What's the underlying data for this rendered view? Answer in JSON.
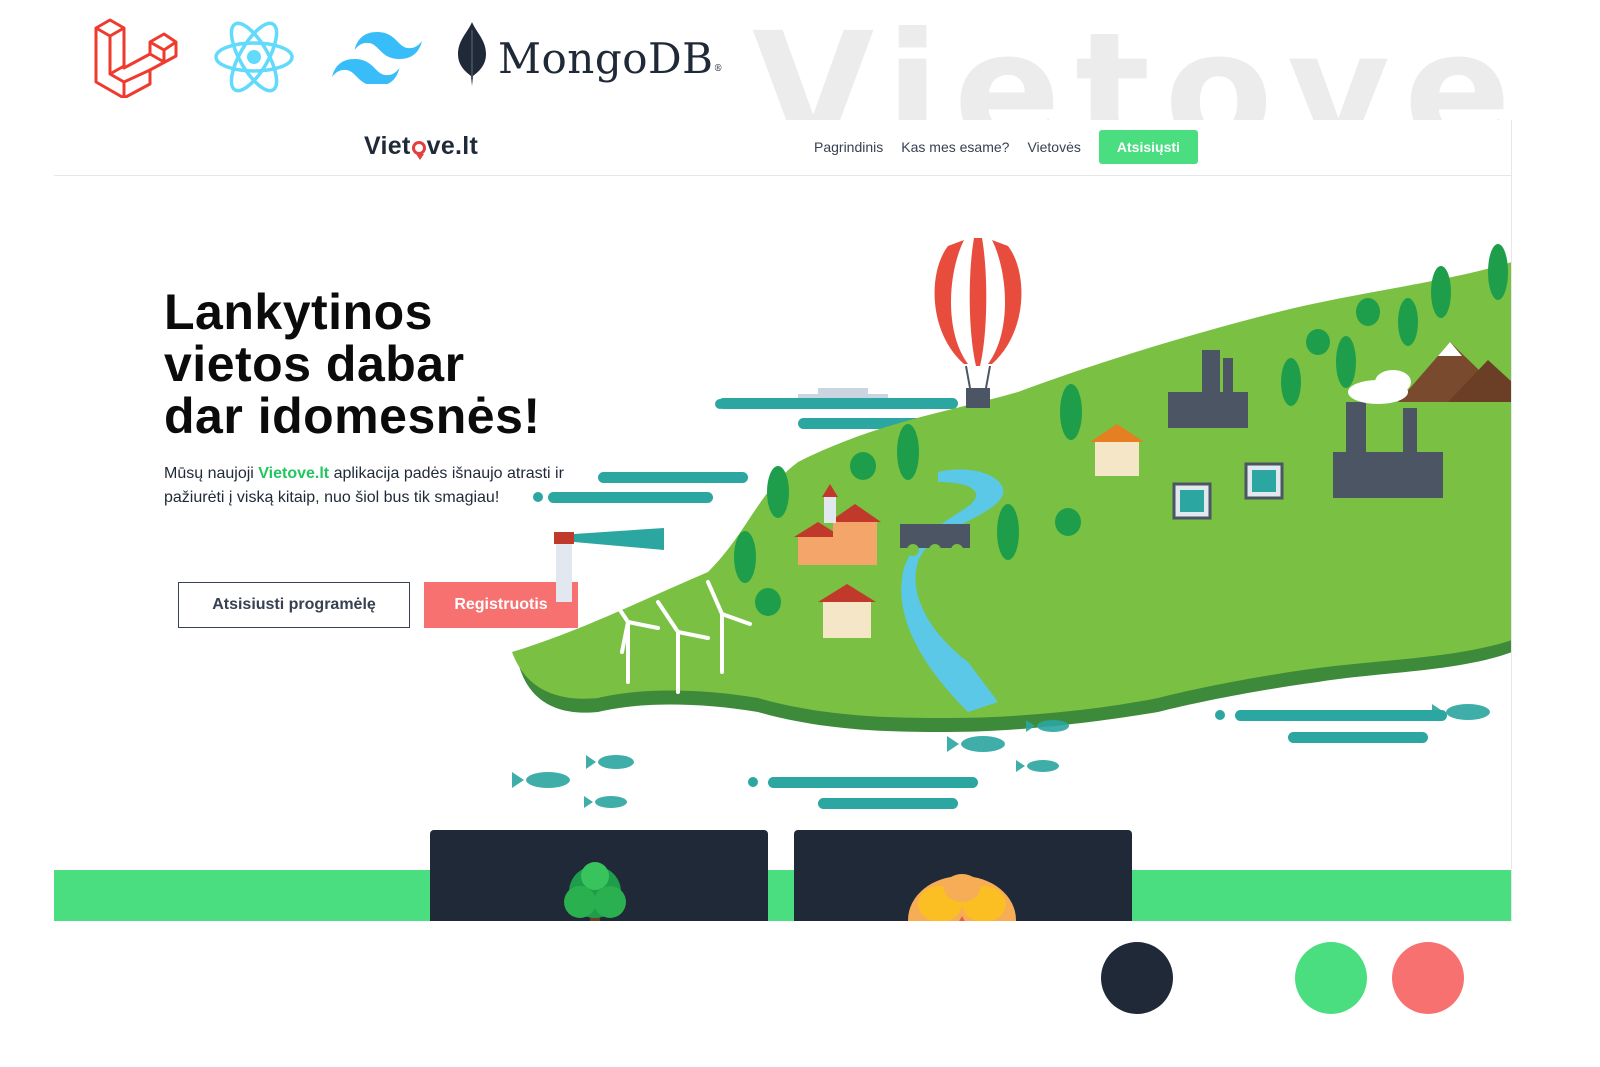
{
  "tech_stack": {
    "logos": [
      "laravel-icon",
      "react-icon",
      "tailwind-icon",
      "mongodb-leaf-icon"
    ],
    "mongodb_wordmark": "MongoDB",
    "mongodb_mark": "®",
    "laravel_color": "#ef3b2d",
    "react_color": "#61dafb",
    "tailwind_color": "#38bdf8",
    "mongodb_color": "#1f2937"
  },
  "background_word": "Vietove",
  "site": {
    "brand": {
      "before": "Viet",
      "after": "ve.lt"
    },
    "nav": {
      "links": [
        "Pagrindinis",
        "Kas mes esame?",
        "Vietovės"
      ],
      "cta": "Atsisiųsti"
    },
    "hero": {
      "title_lines": [
        "Lankytinos",
        "vietos dabar",
        "dar idomesnės!"
      ],
      "desc_before": "Mūsų naujoji ",
      "desc_highlight": "Vietove.lt",
      "desc_after": " aplikacija padės išnaujo atrasti ir pažiurėti į viską kitaip, nuo šiol bus tik smagiau!",
      "primary_button": "Atsisiusti programėlę",
      "secondary_button": "Registruotis"
    },
    "illustration": "island-map-illustration",
    "cards": [
      "tree-icon",
      "brain-icon"
    ]
  },
  "palette": [
    "#1f2937",
    "#4ade80",
    "#f87171"
  ],
  "colors": {
    "accent_green": "#4ade80",
    "accent_red": "#f87171",
    "dark": "#1f2937",
    "teal": "#2ba6a0"
  }
}
